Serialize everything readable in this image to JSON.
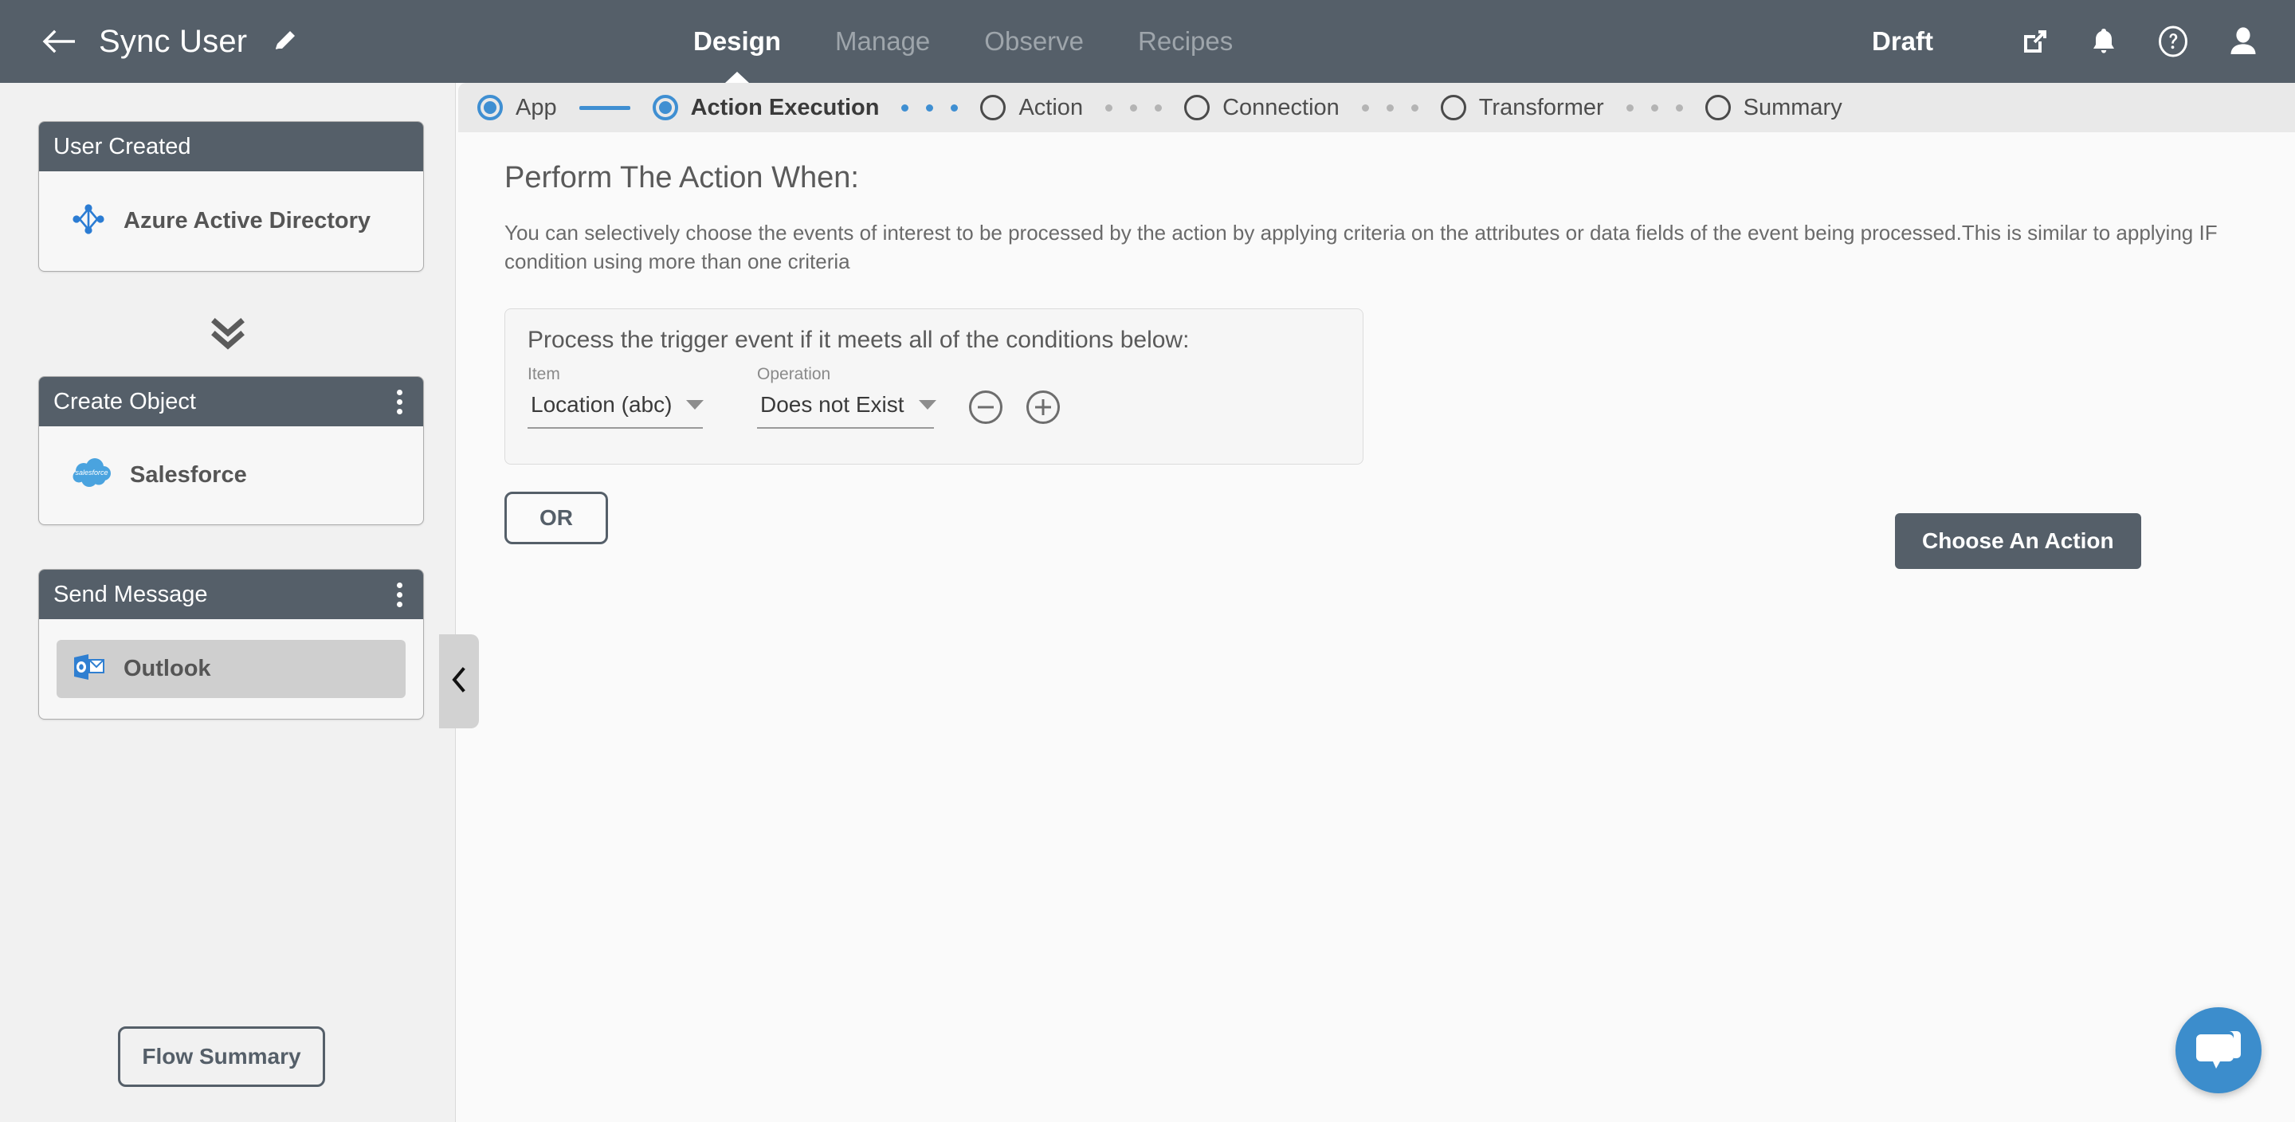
{
  "topbar": {
    "back_icon": "arrow-left-icon",
    "flow_title": "Sync User",
    "edit_icon": "pencil-icon",
    "tabs": [
      {
        "label": "Design",
        "active": true
      },
      {
        "label": "Manage",
        "active": false
      },
      {
        "label": "Observe",
        "active": false
      },
      {
        "label": "Recipes",
        "active": false
      }
    ],
    "status": "Draft",
    "icons": [
      "external-link-icon",
      "bell-icon",
      "help-circle-icon",
      "user-avatar-icon"
    ]
  },
  "sidebar": {
    "cards": [
      {
        "title": "User Created",
        "has_menu": false,
        "app": "Azure Active Directory",
        "app_icon": "azure-active-directory-icon",
        "selected": false
      },
      {
        "title": "Create Object",
        "has_menu": true,
        "app": "Salesforce",
        "app_icon": "salesforce-icon",
        "selected": false
      },
      {
        "title": "Send Message",
        "has_menu": true,
        "app": "Outlook",
        "app_icon": "outlook-icon",
        "selected": true
      }
    ],
    "connector_icon": "double-chevron-down-icon",
    "collapse_icon": "chevron-left-icon",
    "flow_summary_label": "Flow Summary"
  },
  "stepper": {
    "steps": [
      {
        "label": "App",
        "state": "complete"
      },
      {
        "label": "Action Execution",
        "state": "current"
      },
      {
        "label": "Action",
        "state": "pending"
      },
      {
        "label": "Connection",
        "state": "pending"
      },
      {
        "label": "Transformer",
        "state": "pending"
      },
      {
        "label": "Summary",
        "state": "pending"
      }
    ]
  },
  "main": {
    "title": "Perform The Action When:",
    "description": "You can selectively choose the events of interest to be processed by the action by applying criteria on the attributes or data fields of the event being processed.This is similar to applying IF condition using more than one criteria",
    "condition_panel": {
      "heading": "Process the trigger event if it meets all of the conditions below:",
      "item_label": "Item",
      "item_value": "Location (abc)",
      "operation_label": "Operation",
      "operation_value": "Does not Exist",
      "remove_icon": "minus-circle-icon",
      "add_icon": "plus-circle-icon"
    },
    "or_label": "OR",
    "choose_action_label": "Choose An Action",
    "chat_icon": "chat-bubble-icon"
  },
  "colors": {
    "header_dark": "#555f69",
    "accent_blue": "#3f8fd2",
    "chat_blue": "#3c8dcc",
    "panel_gray": "#e9e9e9",
    "selected_row": "#cfcfcf"
  }
}
